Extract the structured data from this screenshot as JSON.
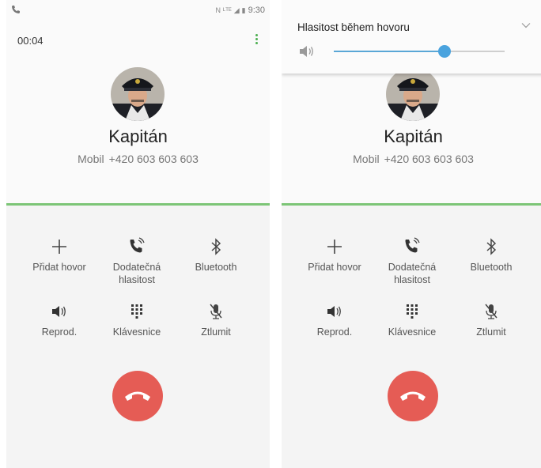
{
  "status_bar": {
    "time": "9:30"
  },
  "call": {
    "timer": "00:04",
    "contact_name": "Kapitán",
    "number_label": "Mobil",
    "number": "+420 603 603 603"
  },
  "actions": {
    "add_call": "Přidat hovor",
    "extra_volume": "Dodatečná hlasitost",
    "bluetooth": "Bluetooth",
    "speaker": "Reprod.",
    "keypad": "Klávesnice",
    "mute": "Ztlumit"
  },
  "volume_panel": {
    "title": "Hlasitost během hovoru",
    "level": 0.65
  },
  "colors": {
    "accent_green": "#7cc576",
    "end_call_red": "#e55c55",
    "slider_blue": "#4aa3de"
  }
}
